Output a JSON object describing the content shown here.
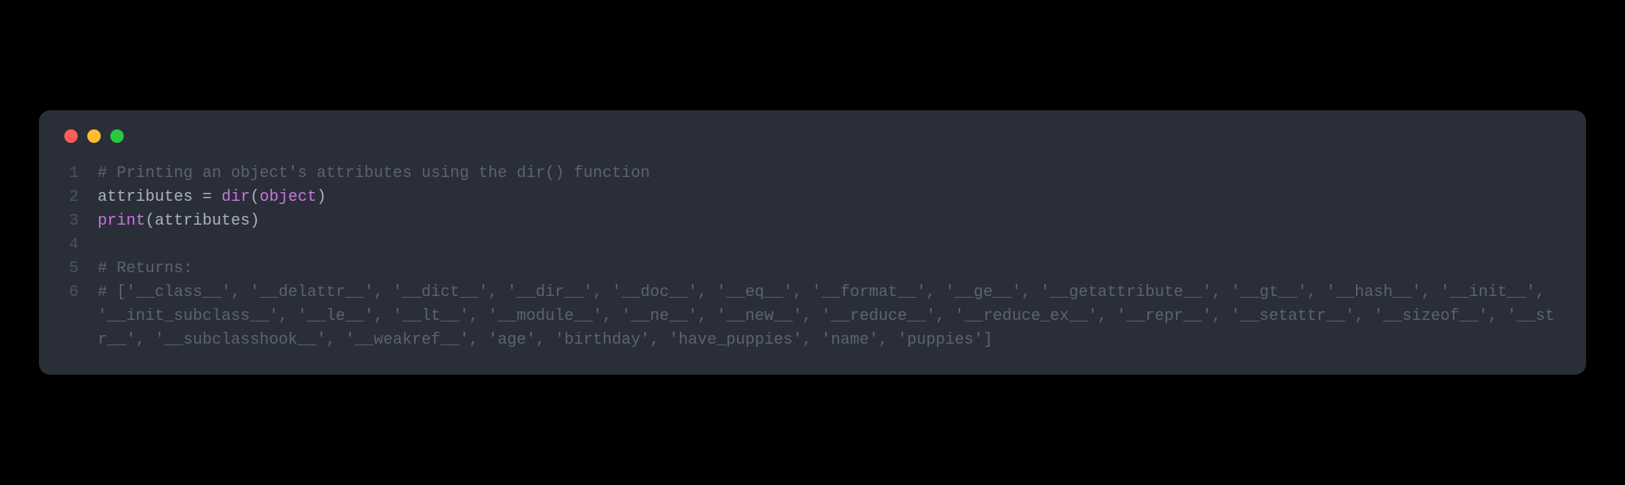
{
  "colors": {
    "background": "#000000",
    "window_bg": "#2a2e38",
    "traffic_red": "#ff5f56",
    "traffic_yellow": "#ffbd2e",
    "traffic_green": "#27c93f",
    "line_number": "#4b5263",
    "comment": "#5c6370",
    "text": "#abb2bf",
    "keyword": "#c678dd",
    "builtin": "#56b6c2"
  },
  "lines": {
    "l1": {
      "num": "1",
      "comment": "# Printing an object's attributes using the dir() function"
    },
    "l2": {
      "num": "2",
      "ident": "attributes",
      "space1": " ",
      "eq": "=",
      "space2": " ",
      "dir": "dir",
      "paren_open": "(",
      "object": "object",
      "paren_close": ")"
    },
    "l3": {
      "num": "3",
      "print": "print",
      "paren_open": "(",
      "attrs": "attributes",
      "paren_close": ")"
    },
    "l4": {
      "num": "4",
      "content": ""
    },
    "l5": {
      "num": "5",
      "comment": "# Returns:"
    },
    "l6": {
      "num": "6",
      "comment": "# ['__class__', '__delattr__', '__dict__', '__dir__', '__doc__', '__eq__', '__format__', '__ge__', '__getattribute__', '__gt__', '__hash__', '__init__', '__init_subclass__', '__le__', '__lt__', '__module__', '__ne__', '__new__', '__reduce__', '__reduce_ex__', '__repr__', '__setattr__', '__sizeof__', '__str__', '__subclasshook__', '__weakref__', 'age', 'birthday', 'have_puppies', 'name', 'puppies']"
    }
  }
}
